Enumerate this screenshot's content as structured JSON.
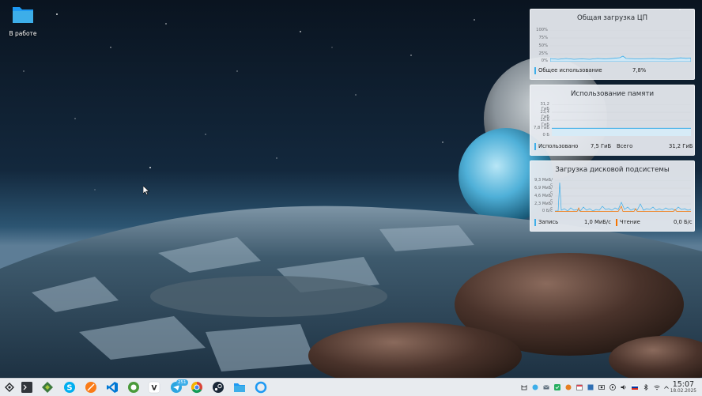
{
  "desktop": {
    "icons": [
      {
        "label": "В работе",
        "icon": "folder-icon"
      }
    ]
  },
  "widgets": {
    "cpu": {
      "title": "Общая загрузка ЦП",
      "y_ticks": [
        "100%",
        "75%",
        "50%",
        "25%",
        "0%"
      ],
      "legend_label": "Общее использование",
      "legend_value": "7,8%",
      "color": "#3daee9"
    },
    "memory": {
      "title": "Использование памяти",
      "y_ticks": [
        "31,2 ГиБ",
        "23,4 ГиБ",
        "15,6 ГиБ",
        "7,8 ГиБ",
        "0 Б"
      ],
      "used_label": "Использовано",
      "used_value": "7,5 ГиБ",
      "total_label": "Всего",
      "total_value": "31,2 ГиБ",
      "color": "#3daee9"
    },
    "disk": {
      "title": "Загрузка дисковой подсистемы",
      "y_ticks": [
        "9,3 МиБ/с",
        "6,9 МиБ/с",
        "4,6 МиБ/с",
        "2,3 МиБ/с",
        "0 Б/с"
      ],
      "write_label": "Запись",
      "write_value": "1,0 МиБ/с",
      "read_label": "Чтение",
      "read_value": "0,0 Б/с",
      "write_color": "#3daee9",
      "read_color": "#f67400"
    }
  },
  "taskbar": {
    "launcher_icon": "kde-launcher-icon",
    "apps": [
      {
        "name": "terminal-icon"
      },
      {
        "name": "android-studio-icon"
      },
      {
        "name": "skype-icon"
      },
      {
        "name": "safari-icon"
      },
      {
        "name": "vscode-icon"
      },
      {
        "name": "aptana-icon"
      },
      {
        "name": "vk-icon"
      },
      {
        "name": "telegram-icon",
        "badge": "251"
      },
      {
        "name": "chrome-icon"
      },
      {
        "name": "steam-icon"
      },
      {
        "name": "dolphin-icon"
      },
      {
        "name": "kde-connect-icon"
      }
    ],
    "tray": [
      "cat-icon",
      "globe-icon",
      "mail-icon",
      "check-icon",
      "photo-icon",
      "calendar-icon",
      "virtualbox-icon",
      "screenshot-icon",
      "media-icon",
      "volume-icon",
      "flag-icon",
      "bluetooth-icon",
      "wifi-icon",
      "expand-icon"
    ],
    "clock": {
      "time": "15:07",
      "date": "18.02.2025"
    }
  }
}
